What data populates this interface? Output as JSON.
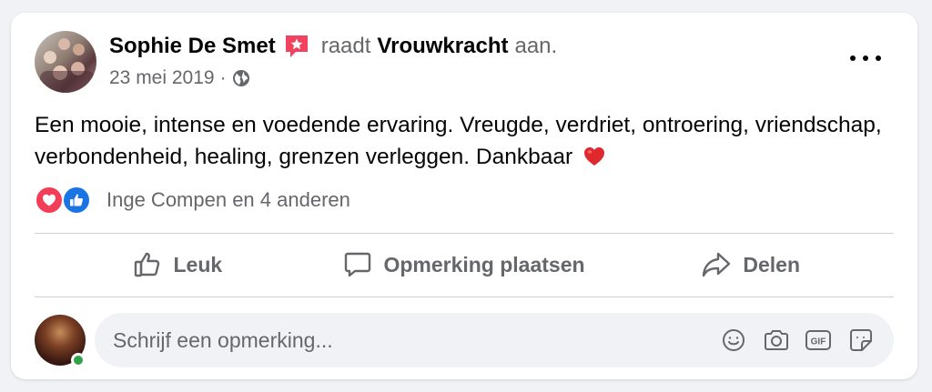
{
  "post": {
    "author_name": "Sophie De Smet",
    "verb": "raadt",
    "page_name": "Vrouwkracht",
    "suffix": "aan.",
    "date": "23 mei 2019",
    "separator": "·",
    "visibility_icon": "globe-icon",
    "badge_icon": "recommend-star-icon",
    "more_icon": "more-horizontal-icon",
    "text": "Een mooie, intense en voedende ervaring. Vreugde, verdriet, ontroering, vriendschap, verbondenheid, healing, grenzen verleggen. Dankbaar",
    "text_emoji": "red-heart-emoji"
  },
  "reactions": {
    "icons": [
      "love-reaction-icon",
      "like-reaction-icon"
    ],
    "summary": "Inge Compen en 4 anderen"
  },
  "actions": [
    {
      "label": "Leuk",
      "icon": "thumbs-up-icon"
    },
    {
      "label": "Opmerking plaatsen",
      "icon": "comment-bubble-icon"
    },
    {
      "label": "Delen",
      "icon": "share-arrow-icon"
    }
  ],
  "comment": {
    "placeholder": "Schrijf een opmerking...",
    "value": "",
    "tools": [
      "emoji-icon",
      "camera-icon",
      "gif-icon",
      "sticker-icon"
    ]
  },
  "colors": {
    "page_bg": "#f0f2f5",
    "card_bg": "#ffffff",
    "primary_text": "#050505",
    "secondary_text": "#65676b",
    "badge": "#f3425f",
    "like_blue": "#1b74e4",
    "love_red": "#f33e58",
    "online_green": "#31a24c"
  }
}
